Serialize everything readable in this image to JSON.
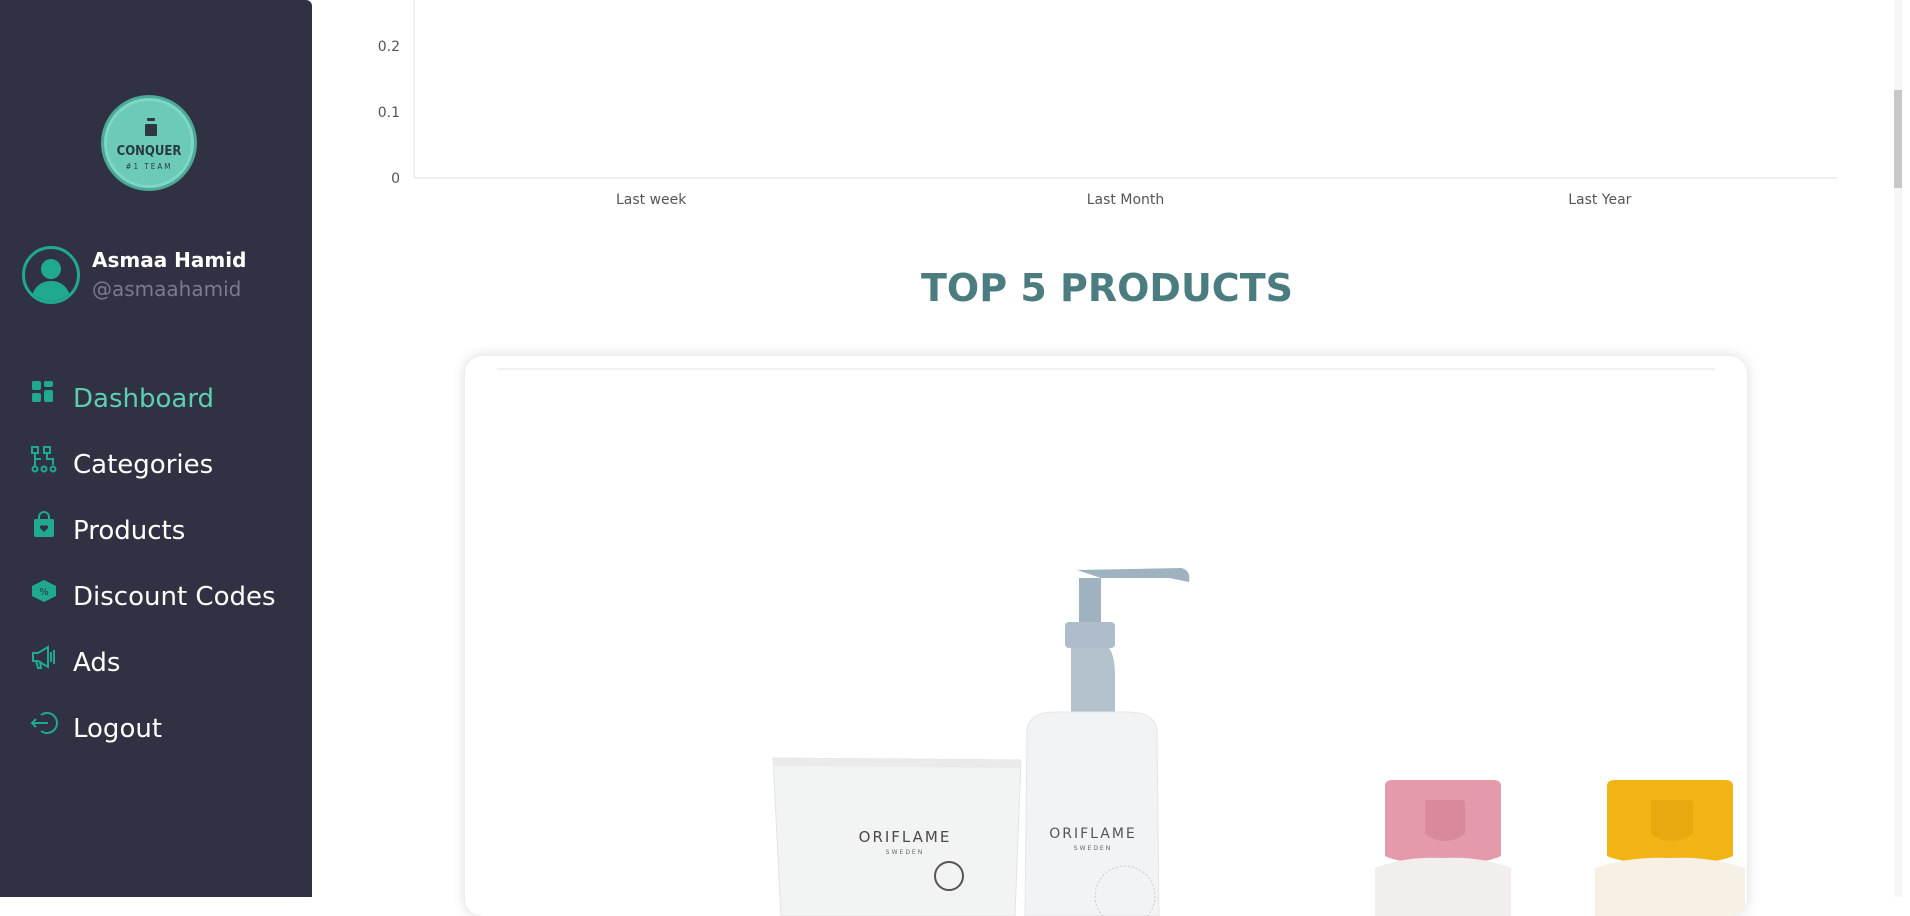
{
  "brand": {
    "logo_line1": "CONQUER",
    "logo_line2": "#1 TEAM",
    "logo_color": "#6ccbb8"
  },
  "profile": {
    "name": "Asmaa Hamid",
    "handle": "@asmaahamid"
  },
  "nav": {
    "items": [
      {
        "label": "Dashboard",
        "icon": "dashboard-icon",
        "active": true
      },
      {
        "label": "Categories",
        "icon": "categories-icon",
        "active": false
      },
      {
        "label": "Products",
        "icon": "shopping-bag-icon",
        "active": false
      },
      {
        "label": "Discount Codes",
        "icon": "discount-ticket-icon",
        "active": false
      },
      {
        "label": "Ads",
        "icon": "megaphone-icon",
        "active": false
      },
      {
        "label": "Logout",
        "icon": "logout-icon",
        "active": false
      }
    ]
  },
  "colors": {
    "sidebar_bg": "#303244",
    "accent": "#5ccfb0",
    "title": "#4a7c80"
  },
  "chart_data": {
    "type": "bar",
    "categories": [
      "Last week",
      "Last Month",
      "Last Year"
    ],
    "values": [
      0,
      0,
      0
    ],
    "y_ticks": [
      "0",
      "0.1",
      "0.2"
    ],
    "ylim": [
      0,
      0.2
    ],
    "grid": false
  },
  "top_products": {
    "title": "TOP 5 PRODUCTS",
    "product_brand": "ORIFLAME",
    "product_origin": "SWEDEN"
  }
}
